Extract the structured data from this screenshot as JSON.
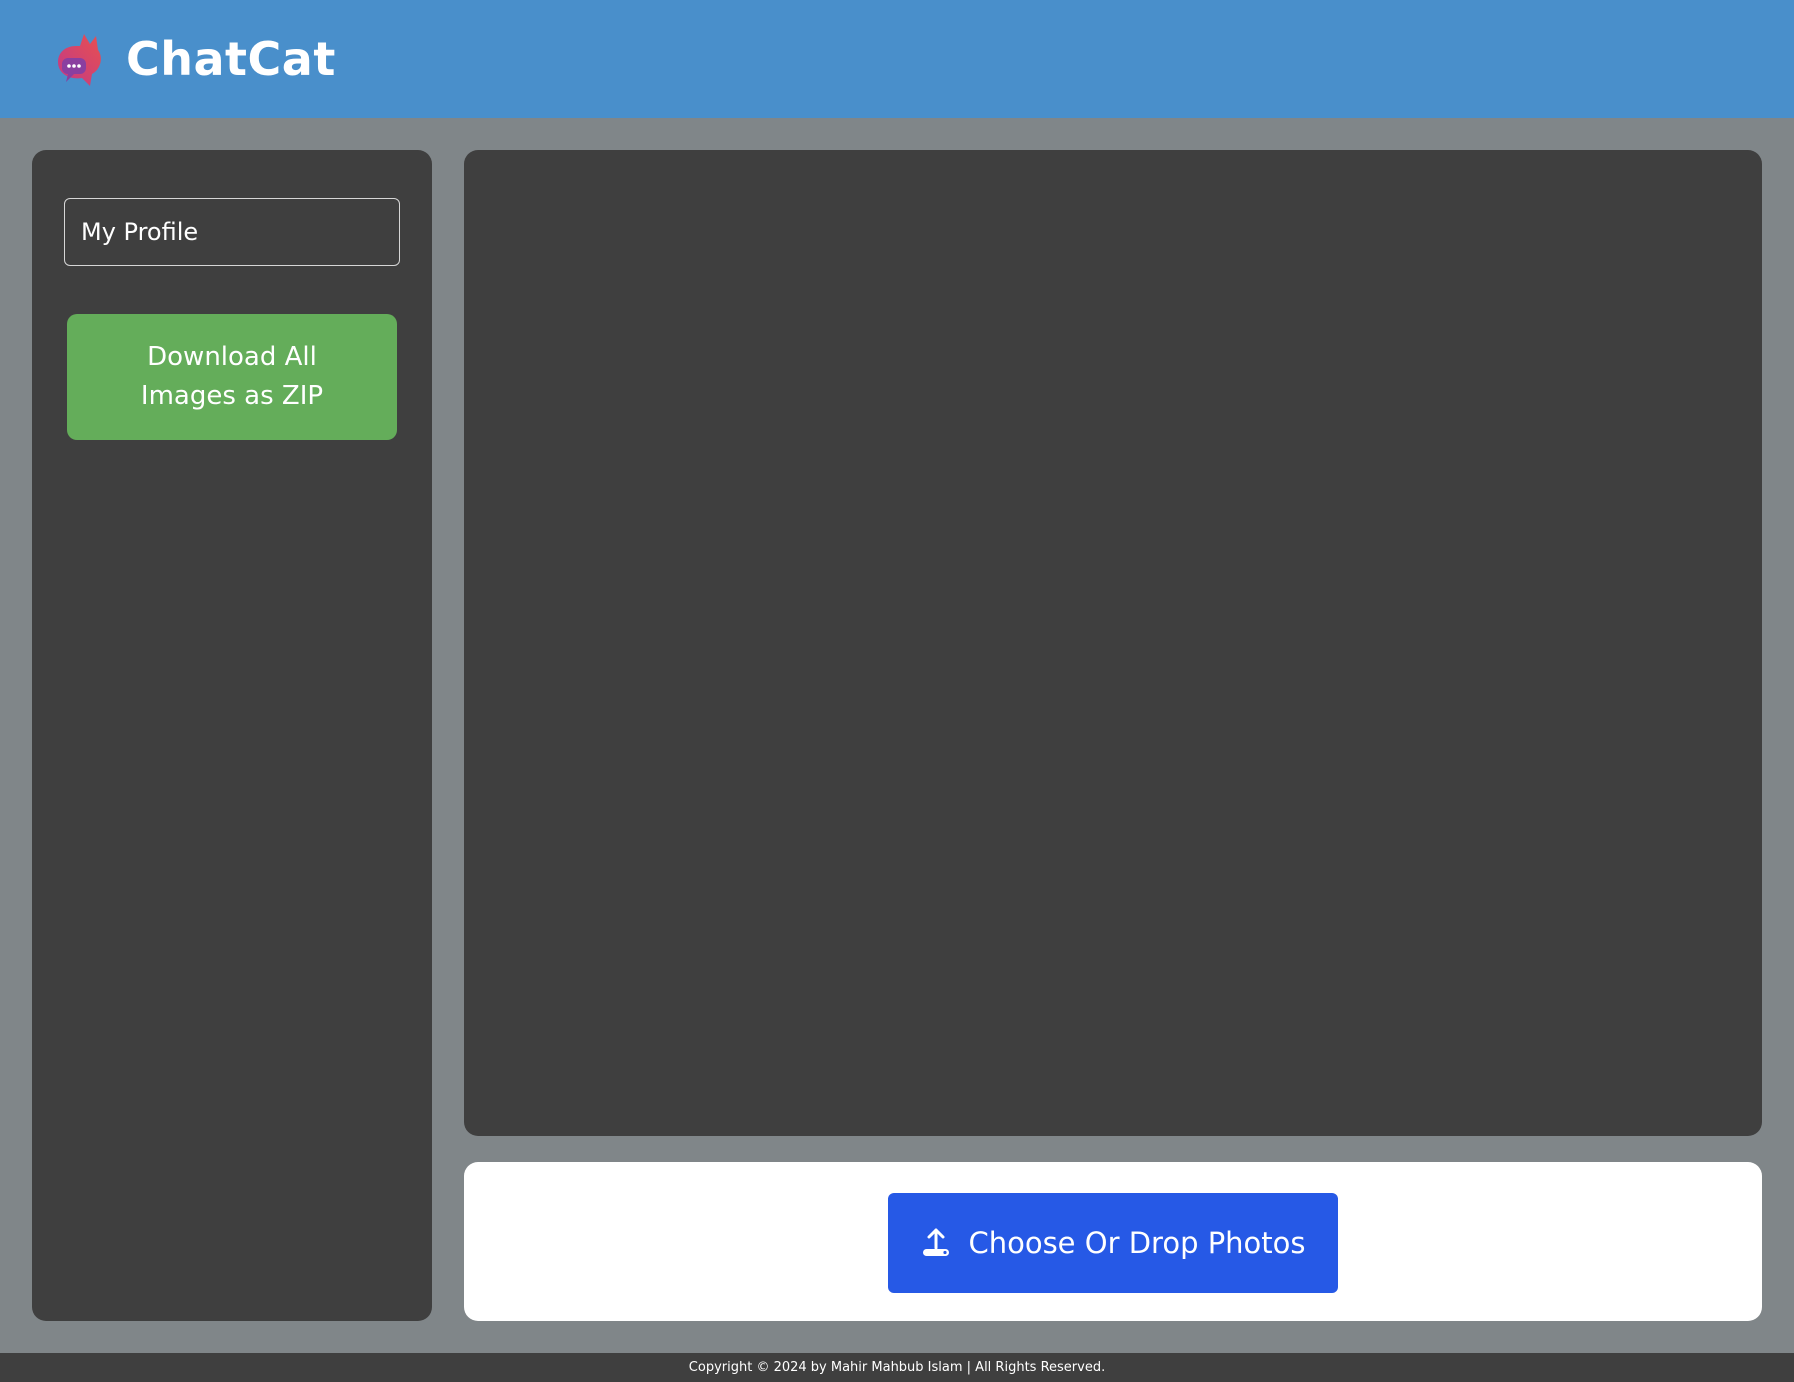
{
  "header": {
    "brand": "ChatCat",
    "logo_icon": "cat-chat-logo-icon",
    "background_color": "#498fcb"
  },
  "sidebar": {
    "profile_label": "My Profile",
    "download_zip_label": "Download All Images as ZIP",
    "download_zip_color": "#64ad5a"
  },
  "upload": {
    "button_label": "Choose Or Drop Photos",
    "button_icon": "upload-icon",
    "button_color": "#2659e6"
  },
  "footer": {
    "copyright": "Copyright © 2024 by Mahir Mahbub Islam | All Rights Reserved."
  }
}
